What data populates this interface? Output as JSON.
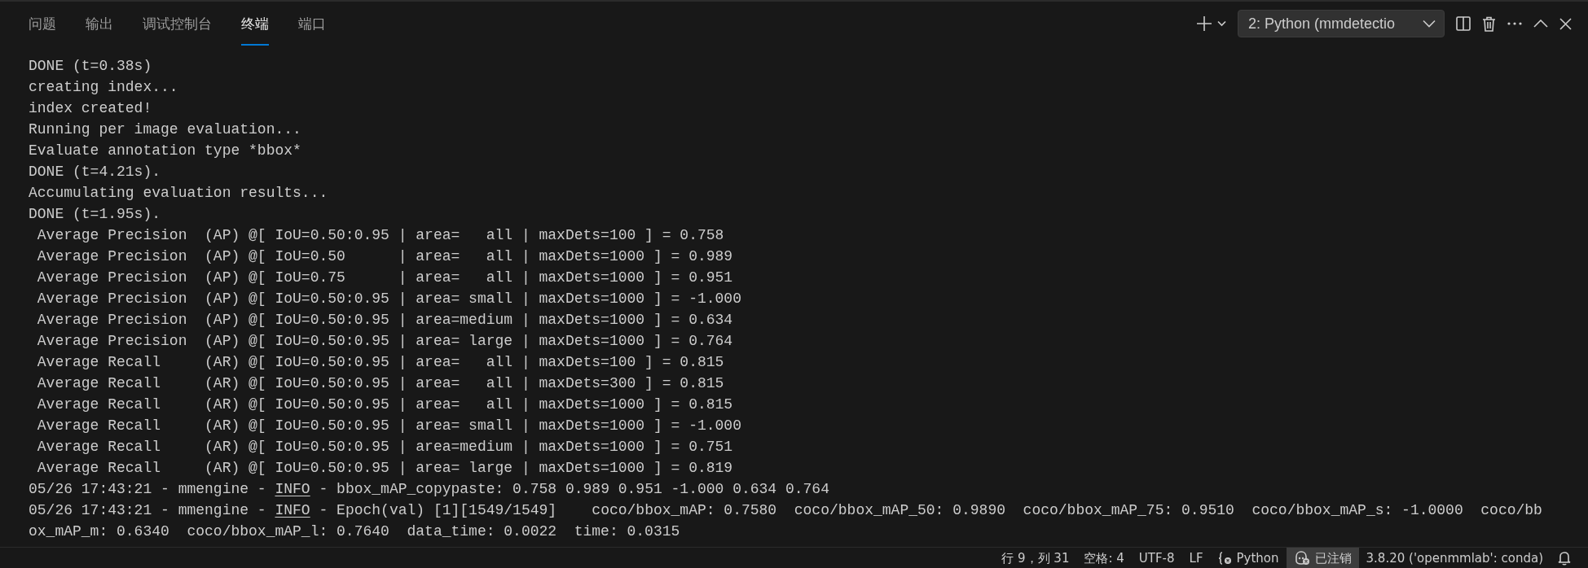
{
  "tabs": [
    {
      "label": "问题",
      "selected": false
    },
    {
      "label": "输出",
      "selected": false
    },
    {
      "label": "调试控制台",
      "selected": false
    },
    {
      "label": "终端",
      "selected": true
    },
    {
      "label": "端口",
      "selected": false
    }
  ],
  "terminal_selector": {
    "value": "2: Python (mmdetectio"
  },
  "terminal": {
    "lines": [
      {
        "kind": "plain",
        "text": "DONE (t=0.38s)"
      },
      {
        "kind": "plain",
        "text": "creating index..."
      },
      {
        "kind": "plain",
        "text": "index created!"
      },
      {
        "kind": "plain",
        "text": "Running per image evaluation..."
      },
      {
        "kind": "plain",
        "text": "Evaluate annotation type *bbox*"
      },
      {
        "kind": "plain",
        "text": "DONE (t=4.21s)."
      },
      {
        "kind": "plain",
        "text": "Accumulating evaluation results..."
      },
      {
        "kind": "plain",
        "text": "DONE (t=1.95s)."
      },
      {
        "kind": "plain",
        "text": " Average Precision  (AP) @[ IoU=0.50:0.95 | area=   all | maxDets=100 ] = 0.758"
      },
      {
        "kind": "plain",
        "text": " Average Precision  (AP) @[ IoU=0.50      | area=   all | maxDets=1000 ] = 0.989"
      },
      {
        "kind": "plain",
        "text": " Average Precision  (AP) @[ IoU=0.75      | area=   all | maxDets=1000 ] = 0.951"
      },
      {
        "kind": "plain",
        "text": " Average Precision  (AP) @[ IoU=0.50:0.95 | area= small | maxDets=1000 ] = -1.000"
      },
      {
        "kind": "plain",
        "text": " Average Precision  (AP) @[ IoU=0.50:0.95 | area=medium | maxDets=1000 ] = 0.634"
      },
      {
        "kind": "plain",
        "text": " Average Precision  (AP) @[ IoU=0.50:0.95 | area= large | maxDets=1000 ] = 0.764"
      },
      {
        "kind": "plain",
        "text": " Average Recall     (AR) @[ IoU=0.50:0.95 | area=   all | maxDets=100 ] = 0.815"
      },
      {
        "kind": "plain",
        "text": " Average Recall     (AR) @[ IoU=0.50:0.95 | area=   all | maxDets=300 ] = 0.815"
      },
      {
        "kind": "plain",
        "text": " Average Recall     (AR) @[ IoU=0.50:0.95 | area=   all | maxDets=1000 ] = 0.815"
      },
      {
        "kind": "plain",
        "text": " Average Recall     (AR) @[ IoU=0.50:0.95 | area= small | maxDets=1000 ] = -1.000"
      },
      {
        "kind": "plain",
        "text": " Average Recall     (AR) @[ IoU=0.50:0.95 | area=medium | maxDets=1000 ] = 0.751"
      },
      {
        "kind": "plain",
        "text": " Average Recall     (AR) @[ IoU=0.50:0.95 | area= large | maxDets=1000 ] = 0.819"
      },
      {
        "kind": "log",
        "prefix": "05/26 17:43:21 - mmengine - ",
        "level": "INFO",
        "message": " - bbox_mAP_copypaste: 0.758 0.989 0.951 -1.000 0.634 0.764"
      },
      {
        "kind": "log",
        "prefix": "05/26 17:43:21 - mmengine - ",
        "level": "INFO",
        "message": " - Epoch(val) [1][1549/1549]    coco/bbox_mAP: 0.7580  coco/bbox_mAP_50: 0.9890  coco/bbox_mAP_75: 0.9510  coco/bbox_mAP_s: -1.0000  coco/bb"
      },
      {
        "kind": "plain",
        "text": "ox_mAP_m: 0.6340  coco/bbox_mAP_l: 0.7640  data_time: 0.0022  time: 0.0315"
      }
    ]
  },
  "status_bar": {
    "items": [
      {
        "kind": "text",
        "text": "行 9，列 31"
      },
      {
        "kind": "text",
        "text": "空格: 4"
      },
      {
        "kind": "text",
        "text": "UTF-8"
      },
      {
        "kind": "text",
        "text": "LF"
      },
      {
        "kind": "language",
        "text": "Python"
      },
      {
        "kind": "account",
        "text": "已注销"
      },
      {
        "kind": "text",
        "text": "3.8.20 ('openmmlab': conda)"
      },
      {
        "kind": "notifications"
      }
    ]
  }
}
